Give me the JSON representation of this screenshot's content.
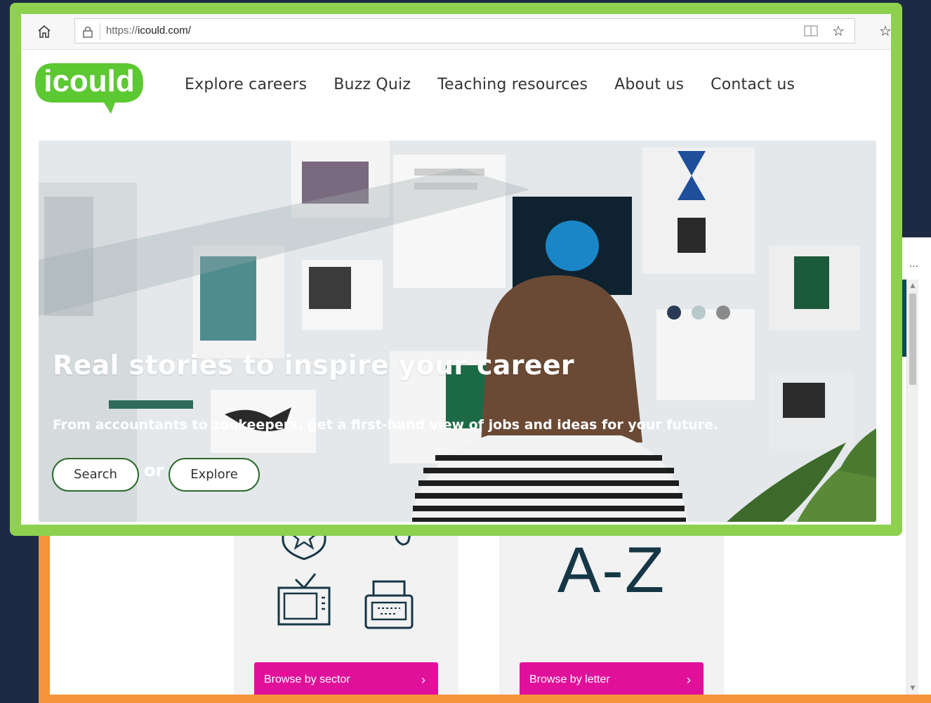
{
  "back_window": {
    "more_label": "...",
    "cards": [
      {
        "button_label": "Browse by sector",
        "chevron": "›",
        "icon": "sector-icons"
      },
      {
        "big_text": "A-Z",
        "button_label": "Browse by letter",
        "chevron": "›"
      }
    ]
  },
  "browser": {
    "url_scheme": "https://",
    "url_host": "icould.com/",
    "icons": [
      "home-icon",
      "lock-icon",
      "reading-view-icon",
      "favorite-star-icon",
      "favorites-list-icon"
    ]
  },
  "site": {
    "logo_text": "icould",
    "nav": [
      "Explore careers",
      "Buzz Quiz",
      "Teaching resources",
      "About us",
      "Contact us"
    ],
    "hero": {
      "title": "Real stories to inspire your career",
      "subtitle": "From accountants to zookeepers, get a first-hand view of jobs and ideas for your future.",
      "search_label": "Search",
      "or_label": "or",
      "explore_label": "Explore"
    }
  },
  "colors": {
    "page_bg": "#1c2a45",
    "front_frame": "#8dd14e",
    "back_frame": "#f5943a",
    "logo_green": "#5cc832",
    "browse_button": "#e0109a",
    "az_text": "#163746"
  }
}
